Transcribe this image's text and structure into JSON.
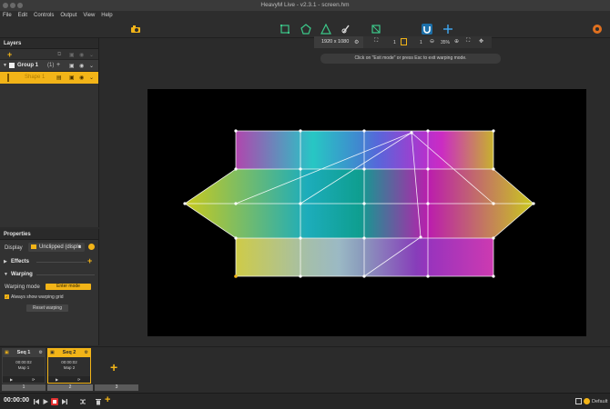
{
  "window": {
    "title": "HeavyM Live - v2.3.1 - screen.hm"
  },
  "menu": [
    "File",
    "Edit",
    "Controls",
    "Output",
    "View",
    "Help"
  ],
  "layers": {
    "header": "Layers",
    "group": {
      "name": "Group 1",
      "count": "(1)"
    },
    "layer": {
      "name": "Shape 1"
    }
  },
  "properties": {
    "header": "Properties",
    "display_label": "Display",
    "display_value": "Unclipped (displa",
    "effects_label": "Effects",
    "warping_label": "Warping",
    "warping_mode_label": "Warping mode",
    "enter_mode_button": "Enter mode",
    "always_show_label": "Always show warping grid",
    "reset_warping_button": "Reset warping"
  },
  "zoom": {
    "resolution": "1920 x 1080",
    "value_a": "1",
    "value_b": "1",
    "percent": "35%"
  },
  "hint": "Click on \"Exit mode\" or press Esc to exit warping mode.",
  "sequences": [
    {
      "title": "Seq 1",
      "time": "00:00:02",
      "map": "Map 1",
      "track": "1"
    },
    {
      "title": "Seq 2",
      "time": "00:00:02",
      "map": "Map 2",
      "track": "2"
    }
  ],
  "track3": "3",
  "status": {
    "time": "00:00:00",
    "default_label": "Default"
  },
  "colors": {
    "accent": "#f2b418",
    "toolbar_green": "#3cc98a",
    "toolbar_blue": "#3fa9f5"
  }
}
